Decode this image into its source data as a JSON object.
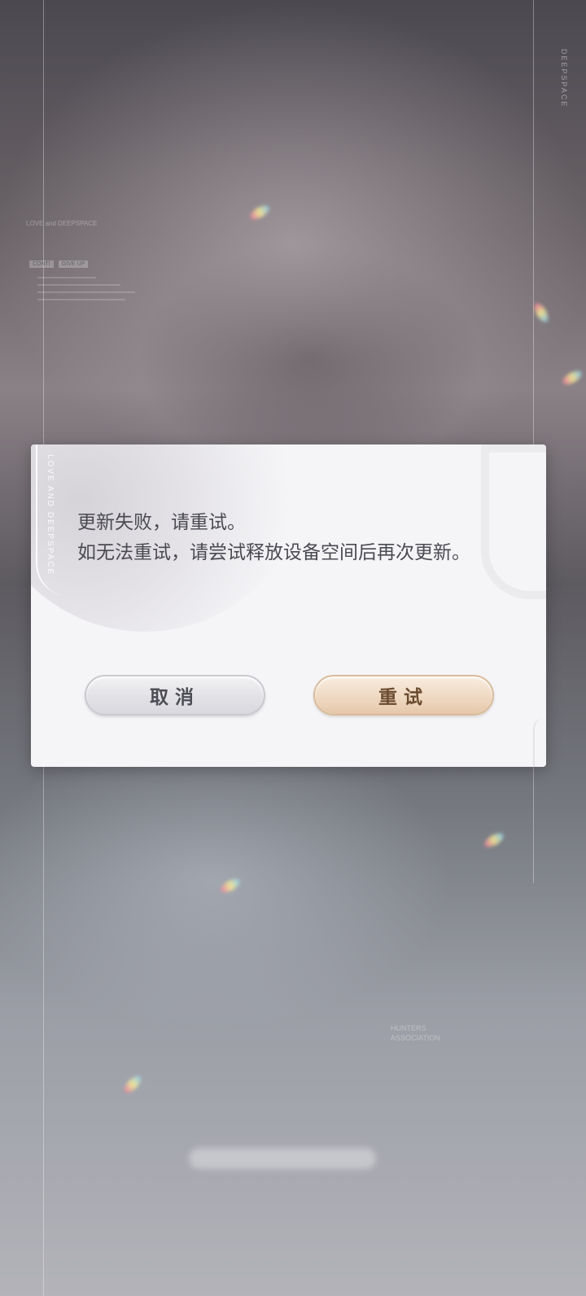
{
  "background": {
    "brand_vertical": "DEEPSPACE",
    "hud": {
      "title_line1": "LOVE and DEEPSPACE",
      "tags": [
        "CONTI",
        "GIVE UP"
      ]
    },
    "bottom_marks": [
      "HUNTERS",
      "ASSOCIATION"
    ]
  },
  "dialog": {
    "deco_vertical": "LOVE AND DEEPSPACE",
    "message_line1": "更新失败，请重试。",
    "message_line2": "如无法重试，请尝试释放设备空间后再次更新。",
    "cancel_label": "取消",
    "retry_label": "重试"
  },
  "colors": {
    "dialog_bg": "#f5f5f8",
    "cancel_button": "#e2e2e6",
    "retry_button": "#efd9c2",
    "text": "#4a4a52"
  }
}
